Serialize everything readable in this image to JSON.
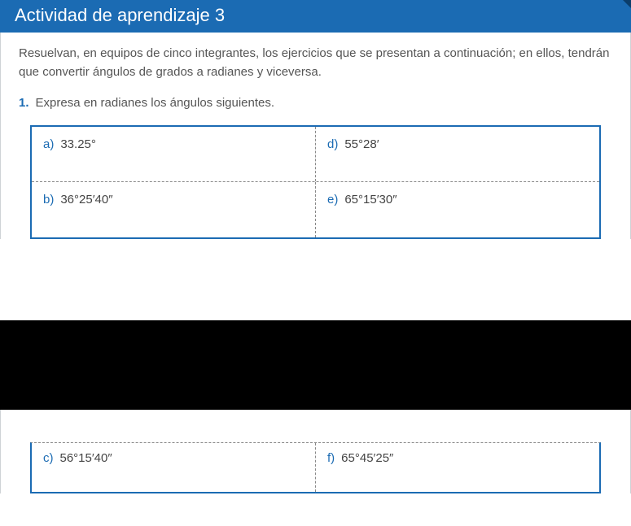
{
  "banner": {
    "title": "Actividad de aprendizaje 3"
  },
  "intro": "Resuelvan, en equipos de cinco integrantes, los ejercicios que se presentan a continuación; en ellos, tendrán que convertir ángulos de grados a radianes y viceversa.",
  "question1": {
    "number": "1.",
    "text": "Expresa en radianes los ángulos siguientes.",
    "options": {
      "a": {
        "label": "a)",
        "value": "33.25°"
      },
      "b": {
        "label": "b)",
        "value": "36°25′40″"
      },
      "c": {
        "label": "c)",
        "value": "56°15′40″"
      },
      "d": {
        "label": "d)",
        "value": "55°28′"
      },
      "e": {
        "label": "e)",
        "value": "65°15′30″"
      },
      "f": {
        "label": "f)",
        "value": "65°45′25″"
      }
    }
  }
}
